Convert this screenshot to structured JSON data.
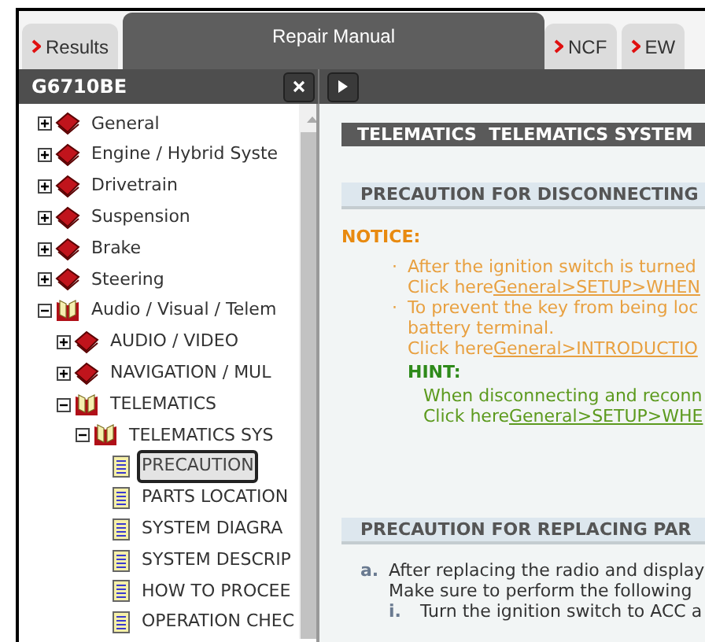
{
  "tabs": [
    {
      "label": "Results",
      "selected": false
    },
    {
      "label": "Repair Manual",
      "selected": true
    },
    {
      "label": "NCF",
      "selected": false
    },
    {
      "label": "EW",
      "selected": false
    }
  ],
  "toolbar": {
    "title": "G6710BE"
  },
  "tree": [
    {
      "label": "General",
      "kind": "book",
      "expanded": false,
      "selected": false
    },
    {
      "label": "Engine / Hybrid Syste",
      "kind": "book",
      "expanded": false,
      "selected": false
    },
    {
      "label": "Drivetrain",
      "kind": "book",
      "expanded": false,
      "selected": false
    },
    {
      "label": "Suspension",
      "kind": "book",
      "expanded": false,
      "selected": false
    },
    {
      "label": "Brake",
      "kind": "book",
      "expanded": false,
      "selected": false
    },
    {
      "label": "Steering",
      "kind": "book",
      "expanded": false,
      "selected": false
    },
    {
      "label": "Audio / Visual / Telem",
      "kind": "book",
      "expanded": true,
      "selected": false,
      "children": [
        {
          "label": "AUDIO / VIDEO",
          "kind": "book",
          "expanded": false,
          "selected": false
        },
        {
          "label": "NAVIGATION / MUL",
          "kind": "book",
          "expanded": false,
          "selected": false
        },
        {
          "label": "TELEMATICS",
          "kind": "book",
          "expanded": true,
          "selected": false,
          "children": [
            {
              "label": "TELEMATICS SYS",
              "kind": "book",
              "expanded": true,
              "selected": false,
              "children": [
                {
                  "label": "PRECAUTION",
                  "kind": "page",
                  "selected": true
                },
                {
                  "label": "PARTS LOCATION",
                  "kind": "page",
                  "selected": false
                },
                {
                  "label": "SYSTEM DIAGRA",
                  "kind": "page",
                  "selected": false
                },
                {
                  "label": "SYSTEM DESCRIP",
                  "kind": "page",
                  "selected": false
                },
                {
                  "label": "HOW TO PROCEE",
                  "kind": "page",
                  "selected": false
                },
                {
                  "label": "OPERATION CHEC",
                  "kind": "page",
                  "selected": false
                }
              ]
            }
          ]
        }
      ]
    }
  ],
  "content": {
    "heading": "TELEMATICS  TELEMATICS SYSTEM",
    "sections": [
      {
        "title": "PRECAUTION FOR DISCONNECTING",
        "blocks": [
          {
            "kind": "notice",
            "label": "NOTICE:",
            "items": [
              {
                "marker": "·",
                "lines": [
                  {
                    "text": "After the ignition switch is turned"
                  },
                  {
                    "text": "Click here",
                    "link": "General>SETUP>WHEN"
                  }
                ]
              },
              {
                "marker": "·",
                "lines": [
                  {
                    "text": "To prevent the key from being loc"
                  },
                  {
                    "text": "battery terminal."
                  },
                  {
                    "text": "Click here",
                    "link": "General>INTRODUCTIO"
                  }
                ]
              }
            ]
          },
          {
            "kind": "hint",
            "label": "HINT:",
            "lines": [
              {
                "text": "When disconnecting and reconn"
              },
              {
                "text": "Click here",
                "link": "General>SETUP>WHE"
              }
            ]
          }
        ]
      },
      {
        "title": "PRECAUTION FOR REPLACING PAR",
        "blocks": [
          {
            "kind": "steps",
            "items": [
              {
                "marker": "a.",
                "lines": [
                  {
                    "text": "After replacing the radio and display"
                  },
                  {
                    "text": "Make sure to perform the following"
                  }
                ],
                "children": [
                  {
                    "marker": "i.",
                    "text": "Turn the ignition switch to ACC a"
                  }
                ]
              }
            ]
          }
        ]
      }
    ]
  }
}
